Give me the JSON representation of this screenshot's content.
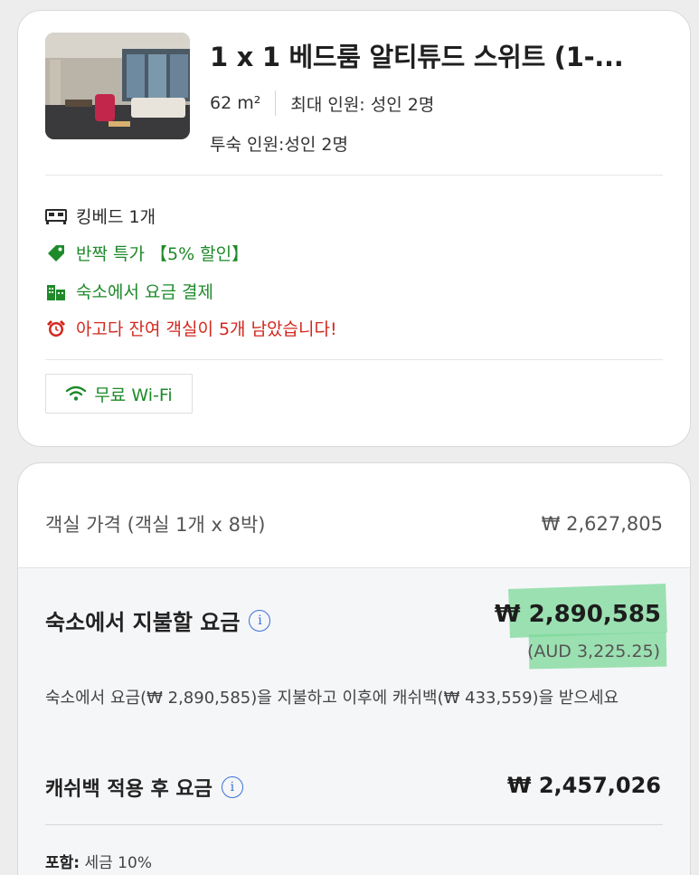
{
  "room": {
    "title": "1 x 1 베드룸 알티튜드 스위트 (1-...",
    "size": "62 m²",
    "max_occupancy": "최대 인원: 성인 2명",
    "guests": "투숙 인원:성인 2명",
    "image_alt": "room photo"
  },
  "features": [
    {
      "icon": "bed-icon",
      "text": "킹베드 1개",
      "color": "#2b2b2b"
    },
    {
      "icon": "tag-icon",
      "text": "반짝 특가 【5% 할인】",
      "color": "#1e8a2a"
    },
    {
      "icon": "building-icon",
      "text": "숙소에서 요금 결제",
      "color": "#1e8a2a"
    },
    {
      "icon": "alarm-clock-icon",
      "text": "아고다 잔여 객실이 5개 남았습니다!",
      "color": "#d1271e"
    }
  ],
  "amenity": {
    "icon": "wifi-icon",
    "text": "무료 Wi-Fi"
  },
  "pricing": {
    "room_price_label": "객실 가격 (객실 1개 x 8박)",
    "room_price_value": "₩ 2,627,805",
    "pay_at_property_label": "숙소에서 지불할 요금",
    "pay_at_property_value": "₩ 2,890,585",
    "pay_at_property_aud": "(AUD 3,225.25)",
    "note": "숙소에서 요금(₩ 2,890,585)을 지불하고 이후에 캐쉬백(₩ 433,559)을 받으세요",
    "after_cashback_label": "캐쉬백 적용 후 요금",
    "after_cashback_value": "₩ 2,457,026",
    "includes_label": "포함:",
    "includes_value": "세금 10%"
  },
  "colors": {
    "green": "#1e8a2a",
    "red": "#d1271e",
    "info_blue": "#3b6fd8",
    "highlight": "#7cd89a"
  }
}
